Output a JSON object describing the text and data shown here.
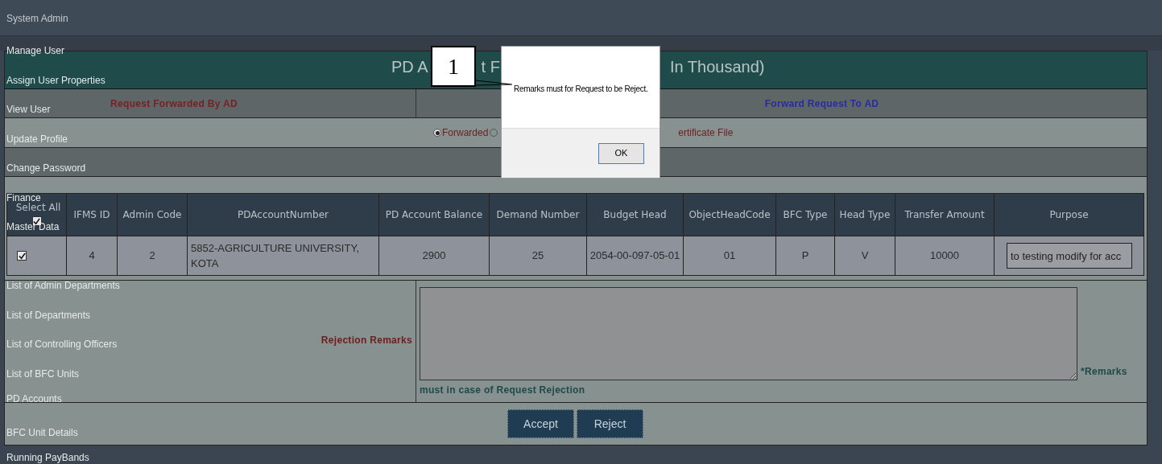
{
  "sidebar_menu": {
    "header": "System Admin",
    "items": [
      {
        "label": "Manage User"
      },
      {
        "label": "Assign User Properties"
      },
      {
        "label": "View User"
      },
      {
        "label": "Update Profile"
      },
      {
        "label": "Change Password"
      },
      {
        "label": "Finance"
      },
      {
        "label": "Master Data"
      },
      {
        "label": "List of Admin Departments"
      },
      {
        "label": "List of Departments"
      },
      {
        "label": "List of Controlling Officers"
      },
      {
        "label": "List of BFC Units"
      },
      {
        "label": "PD Accounts"
      },
      {
        "label": "BFC Unit Details"
      },
      {
        "label": "Running PayBands"
      }
    ]
  },
  "panel": {
    "title_fragments": [
      "PD A",
      "t F",
      "In Thousand)"
    ],
    "request_tabs": [
      {
        "label": "Request Forwarded By AD",
        "kind": "incoming"
      },
      {
        "label": "Forward Request To AD",
        "kind": "outgoing"
      }
    ],
    "radio_options": [
      {
        "label": "Forwarded",
        "selected": true
      },
      {
        "selected": false
      }
    ],
    "radio_trailing_text": "ertificate File"
  },
  "table": {
    "select_all": {
      "label": "Select All",
      "checked": true
    },
    "columns": [
      "IFMS ID",
      "Admin Code",
      "PDAccountNumber",
      "PD Account Balance",
      "Demand Number",
      "Budget Head",
      "ObjectHeadCode",
      "BFC Type",
      "Head Type",
      "Transfer Amount",
      "Purpose"
    ],
    "rows": [
      {
        "checked": true,
        "cells": [
          "4",
          "2",
          "5852-AGRICULTURE UNIVERSITY, KOTA",
          "2900",
          "25",
          "2054-00-097-05-01",
          "01",
          "P",
          "V",
          "10000"
        ],
        "purpose": "to testing modify for acc"
      }
    ]
  },
  "rejection_remarks": {
    "label": "Rejection Remarks",
    "required_note": "*Remarks",
    "note_continued": "must in case of Request Rejection"
  },
  "buttons": [
    "Accept",
    "Reject"
  ],
  "dialog": {
    "message": "Remarks must for Request to be Reject.",
    "button": "OK"
  },
  "callout": {
    "label": "1"
  }
}
